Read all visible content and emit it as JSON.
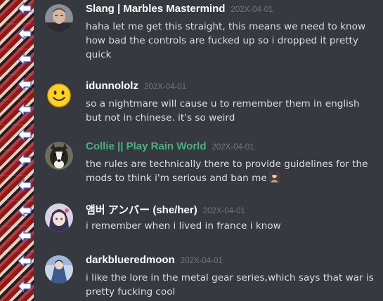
{
  "colors": {
    "background": "#36393f",
    "username_default": "#ffffff",
    "username_role_green": "#43b581",
    "timestamp": "#72767d",
    "message_text": "#dcddde"
  },
  "messages": [
    {
      "author": "Slang | Marbles Mastermind",
      "timestamp": "202X-04-01",
      "text": "haha let me get this straight, this means we need to know how bad the controls are fucked up so i dropped it pretty quick",
      "avatar_icon": "man-photo-avatar"
    },
    {
      "author": "idunnololz",
      "timestamp": "202X-04-01",
      "text": "so a nightmare will cause u to remember them in english but not in chinese. it's so weird",
      "avatar_icon": "smiley-face-avatar"
    },
    {
      "author": "Collie || Play Rain World",
      "timestamp": "202X-04-01",
      "text": "the rules are technically there to provide guidelines for the mods to think i'm serious and ban me",
      "avatar_icon": "collie-dog-avatar",
      "trailing_emoji": "crying-person-emoji"
    },
    {
      "author": "앰버 アンバー (she/her)",
      "timestamp": "202X-04-01",
      "text": "i remember when i lived in france i know",
      "avatar_icon": "anime-girl-avatar"
    },
    {
      "author": "darkblueredmoon",
      "timestamp": "202X-04-01",
      "text": "i like the lore in the metal gear series,which says that war is pretty fucking cool",
      "avatar_icon": "blue-art-avatar"
    }
  ]
}
